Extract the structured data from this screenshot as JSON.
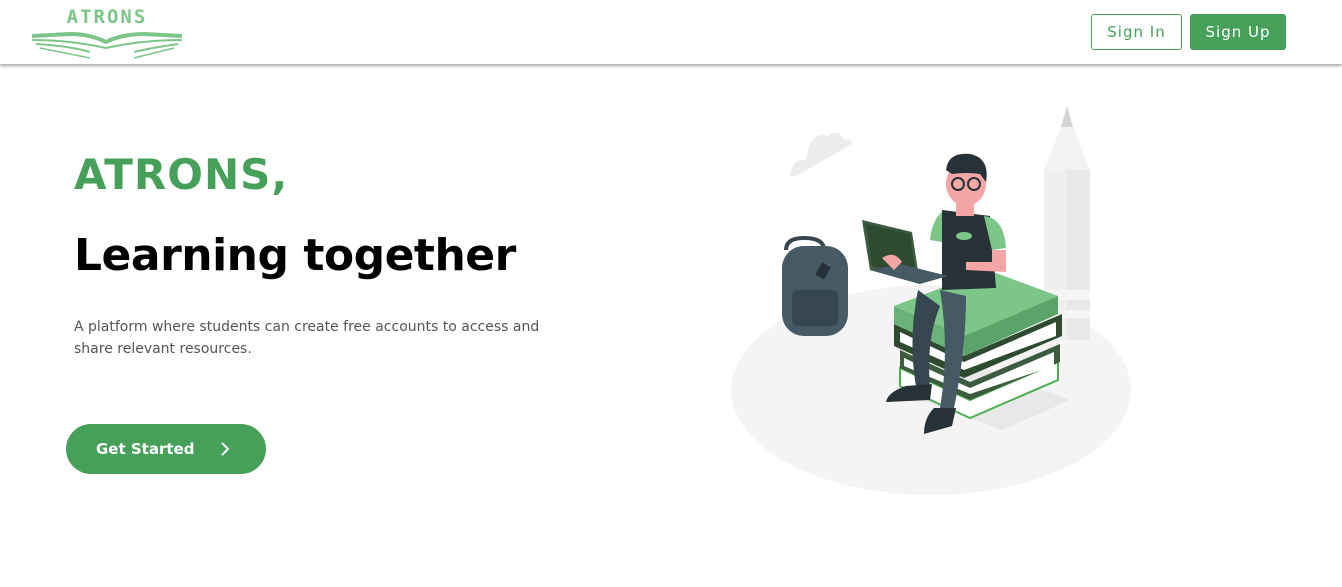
{
  "header": {
    "logo_text": "ATRONS",
    "signin_label": "Sign In",
    "signup_label": "Sign Up"
  },
  "hero": {
    "brand": "ATRONS,",
    "title": "Learning together",
    "description": "A platform where students can create free accounts to access and share relevant resources.",
    "cta_label": "Get Started"
  },
  "colors": {
    "brand_green": "#46a05a",
    "light_green": "#7cc68a"
  },
  "icons": {
    "cta_icon": "chevron-right-icon"
  }
}
